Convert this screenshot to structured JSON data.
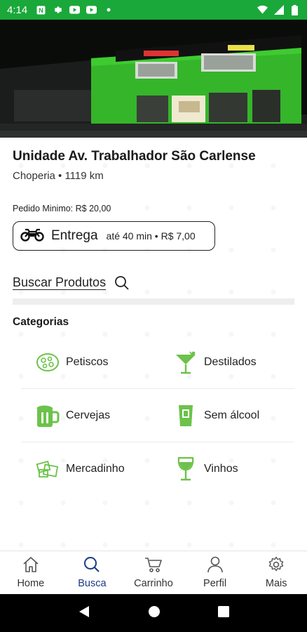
{
  "status_bar": {
    "time": "4:14",
    "left_icons": [
      "notification-n-icon",
      "settings-icon",
      "youtube-icon",
      "youtube-icon",
      "dot-icon"
    ],
    "right_icons": [
      "wifi-icon",
      "signal-icon",
      "battery-icon"
    ]
  },
  "store": {
    "name": "Unidade Av. Trabalhador São Carlense",
    "meta": "Choperia • 1119 km",
    "min_order": "Pedido Minimo: R$ 20,00"
  },
  "delivery": {
    "label": "Entrega",
    "info": "até 40 min • R$ 7,00",
    "icon": "motorcycle-icon"
  },
  "search": {
    "label": "Buscar Produtos"
  },
  "categories": {
    "title": "Categorias",
    "items": [
      {
        "label": "Petiscos",
        "icon": "snack-icon"
      },
      {
        "label": "Destilados",
        "icon": "cocktail-icon"
      },
      {
        "label": "Cervejas",
        "icon": "beer-mug-icon"
      },
      {
        "label": "Sem álcool",
        "icon": "soft-drink-icon"
      },
      {
        "label": "Mercadinho",
        "icon": "grocery-icon"
      },
      {
        "label": "Vinhos",
        "icon": "wine-glass-icon"
      }
    ]
  },
  "bottom_nav": {
    "items": [
      {
        "label": "Home",
        "icon": "home-icon"
      },
      {
        "label": "Busca",
        "icon": "search-icon"
      },
      {
        "label": "Carrinho",
        "icon": "cart-icon"
      },
      {
        "label": "Perfil",
        "icon": "person-icon"
      },
      {
        "label": "Mais",
        "icon": "gear-icon"
      }
    ],
    "active": "Busca"
  },
  "colors": {
    "status_bar": "#1aa83a",
    "accent_green": "#6cc24a",
    "nav_active": "#1a3c82"
  }
}
